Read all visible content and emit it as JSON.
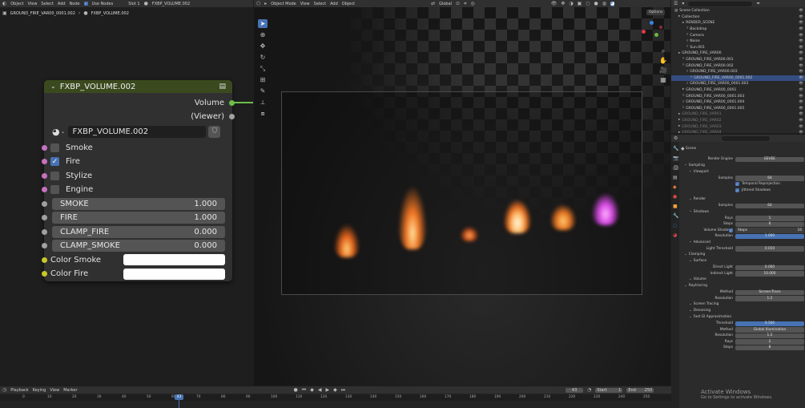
{
  "node_editor": {
    "header": {
      "mode": "Object",
      "menus": [
        "View",
        "Select",
        "Add",
        "Node"
      ],
      "use_nodes_label": "Use Nodes",
      "slot": "Slot 1",
      "material": "FXBP_VOLUME.002"
    },
    "breadcrumb": [
      "GROUND_FIRE_VAR00_0001.002",
      "FXBP_VOLUME.002"
    ],
    "node": {
      "title": "FXBP_VOLUME.002",
      "outputs": [
        "Volume",
        "(Viewer)"
      ],
      "material_name": "FXBP_VOLUME.002",
      "toggles": [
        {
          "label": "Smoke",
          "checked": false
        },
        {
          "label": "Fire",
          "checked": true
        },
        {
          "label": "Stylize",
          "checked": false
        },
        {
          "label": "Engine",
          "checked": false
        }
      ],
      "values": [
        {
          "label": "SMOKE",
          "value": "1.000"
        },
        {
          "label": "FIRE",
          "value": "1.000"
        },
        {
          "label": "CLAMP_FIRE",
          "value": "0.000"
        },
        {
          "label": "CLAMP_SMOKE",
          "value": "0.000"
        }
      ],
      "colors": [
        {
          "label": "Color Smoke",
          "value": "#ffffff"
        },
        {
          "label": "Color Fire",
          "value": "#ffffff"
        }
      ]
    }
  },
  "viewport": {
    "header": {
      "mode": "Object Mode",
      "menus": [
        "View",
        "Select",
        "Add",
        "Object"
      ],
      "transform": "Global",
      "options": "Options"
    }
  },
  "outliner": {
    "search_placeholder": "",
    "rows": [
      {
        "label": "Scene Collection",
        "depth": 0,
        "sel": false,
        "dim": false
      },
      {
        "label": "Collection",
        "depth": 1,
        "sel": false,
        "dim": false
      },
      {
        "label": "RENDER_SCENE",
        "depth": 2,
        "sel": false,
        "dim": false
      },
      {
        "label": "Backdrop",
        "depth": 3,
        "sel": false,
        "dim": false
      },
      {
        "label": "Camera",
        "depth": 3,
        "sel": false,
        "dim": false
      },
      {
        "label": "Noise",
        "depth": 3,
        "sel": false,
        "dim": false
      },
      {
        "label": "Sun.001",
        "depth": 3,
        "sel": false,
        "dim": false
      },
      {
        "label": "GROUND_FIRE_VAR00",
        "depth": 1,
        "sel": false,
        "dim": false
      },
      {
        "label": "GROUND_FIRE_VAR00.001",
        "depth": 2,
        "sel": false,
        "dim": false
      },
      {
        "label": "GROUND_FIRE_VAR00.002",
        "depth": 2,
        "sel": false,
        "dim": false
      },
      {
        "label": "GROUND_FIRE_VAR00.003",
        "depth": 3,
        "sel": false,
        "dim": false
      },
      {
        "label": "GROUND_FIRE_VAR00_0001.002",
        "depth": 4,
        "sel": true,
        "dim": false
      },
      {
        "label": "GROUND_FIRE_VAR00_0001.003",
        "depth": 3,
        "sel": false,
        "dim": false
      },
      {
        "label": "GROUND_FIRE_VAR00_0001",
        "depth": 2,
        "sel": false,
        "dim": false
      },
      {
        "label": "GROUND_FIRE_VAR00_0001.003",
        "depth": 2,
        "sel": false,
        "dim": false
      },
      {
        "label": "GROUND_FIRE_VAR00_0001.004",
        "depth": 2,
        "sel": false,
        "dim": false
      },
      {
        "label": "GROUND_FIRE_VAR00_0001.005",
        "depth": 2,
        "sel": false,
        "dim": false
      },
      {
        "label": "GROUND_FIRE_VAR01",
        "depth": 1,
        "sel": false,
        "dim": true
      },
      {
        "label": "GROUND_FIRE_VAR02",
        "depth": 1,
        "sel": false,
        "dim": true
      },
      {
        "label": "GROUND_FIRE_VAR03",
        "depth": 1,
        "sel": false,
        "dim": true
      },
      {
        "label": "GROUND_FIRE_VAR04",
        "depth": 1,
        "sel": false,
        "dim": true
      }
    ]
  },
  "properties": {
    "scene_label": "Scene",
    "rows": [
      {
        "kind": "field",
        "label": "Render Engine",
        "value": "EEVEE"
      },
      {
        "kind": "section",
        "label": "Sampling"
      },
      {
        "kind": "sub",
        "label": "Viewport"
      },
      {
        "kind": "field",
        "label": "Samples",
        "value": "64"
      },
      {
        "kind": "check",
        "label": "Temporal Reprojection"
      },
      {
        "kind": "check",
        "label": "Jittered Shadows"
      },
      {
        "kind": "gap"
      },
      {
        "kind": "sub",
        "label": "Render"
      },
      {
        "kind": "field",
        "label": "Samples",
        "value": "64"
      },
      {
        "kind": "sub",
        "label": "Shadows"
      },
      {
        "kind": "field",
        "label": "Rays",
        "value": "1"
      },
      {
        "kind": "field",
        "label": "Steps",
        "value": "6"
      },
      {
        "kind": "checkfield",
        "label": "Volume Shadows",
        "value": "Steps",
        "extra": "16"
      },
      {
        "kind": "fieldblue",
        "label": "Resolution",
        "value": "1.000"
      },
      {
        "kind": "sub",
        "label": "Advanced"
      },
      {
        "kind": "field",
        "label": "Light Threshold",
        "value": "0.010"
      },
      {
        "kind": "section",
        "label": "Clamping"
      },
      {
        "kind": "sub",
        "label": "Surface"
      },
      {
        "kind": "field",
        "label": "Direct Light",
        "value": "0.000"
      },
      {
        "kind": "field",
        "label": "Indirect Light",
        "value": "10.000"
      },
      {
        "kind": "sub",
        "label": "Volume"
      },
      {
        "kind": "section",
        "label": "Raytracing"
      },
      {
        "kind": "field",
        "label": "Method",
        "value": "Screen-Trace"
      },
      {
        "kind": "field",
        "label": "Resolution",
        "value": "1:2"
      },
      {
        "kind": "sub",
        "label": "Screen Tracing"
      },
      {
        "kind": "sub",
        "label": "Denoising"
      },
      {
        "kind": "sub",
        "label": "Fast GI Approximation"
      },
      {
        "kind": "fieldblue",
        "label": "Threshold",
        "value": "0.500"
      },
      {
        "kind": "field",
        "label": "Method",
        "value": "Global Illumination"
      },
      {
        "kind": "field",
        "label": "Resolution",
        "value": "1:2"
      },
      {
        "kind": "field",
        "label": "Rays",
        "value": "2"
      },
      {
        "kind": "field",
        "label": "Steps",
        "value": "8"
      }
    ]
  },
  "timeline": {
    "menus": [
      "Playback",
      "Keying",
      "View",
      "Marker"
    ],
    "current_frame": "43",
    "start_label": "Start",
    "start": "1",
    "end_label": "End",
    "end": "250",
    "ticks": [
      "0",
      "10",
      "20",
      "30",
      "40",
      "50",
      "60",
      "70",
      "80",
      "90",
      "100",
      "110",
      "120",
      "130",
      "140",
      "150",
      "160",
      "170",
      "180",
      "190",
      "200",
      "210",
      "220",
      "230",
      "240",
      "250"
    ]
  },
  "watermark": {
    "line1": "Activate Windows",
    "line2": "Go to Settings to activate Windows."
  }
}
